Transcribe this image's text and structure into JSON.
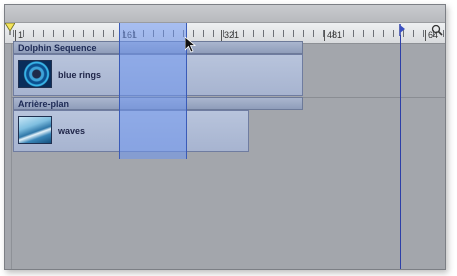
{
  "ruler": {
    "ticks": [
      "1",
      "161",
      "321",
      "481",
      "64"
    ]
  },
  "tracks": {
    "group1": {
      "title": "Dolphin Sequence"
    },
    "clip1": {
      "label": "blue rings",
      "thumbnail": "blue-rings-thumbnail"
    },
    "group2": {
      "title": "Arrière-plan"
    },
    "clip2": {
      "label": "waves",
      "thumbnail": "waves-thumbnail"
    }
  },
  "icons": {
    "start_marker": "in-point-marker-icon",
    "end_marker": "out-point-marker-icon",
    "zoom": "zoom-icon",
    "cursor": "mouse-cursor-icon"
  },
  "colors": {
    "background": "#a3a6ac",
    "selection": "#6e96f0",
    "clip": "#a7b4d0",
    "group_header": "#8f9dba",
    "out_line": "#2d3fa8"
  }
}
